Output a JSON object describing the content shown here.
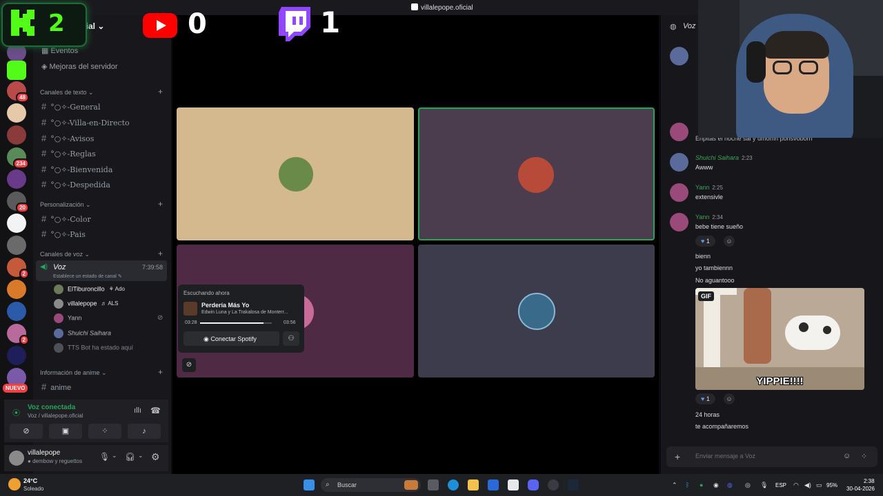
{
  "window": {
    "title": "villalepope.oficial"
  },
  "overlay": {
    "kick_count": "2",
    "youtube_count": "0",
    "twitch_count": "1"
  },
  "server": {
    "name": "cial"
  },
  "sidebar": {
    "nav": [
      "Eventos",
      "Mejoras del servidor"
    ],
    "categories": {
      "text": "Canales de texto",
      "personal": "Personalización",
      "voice": "Canales de voz",
      "anime": "Información de anime"
    },
    "text_channels": [
      "°○✧-General",
      "°○✧-Villa-en-Directo",
      "°○✧-Avisos",
      "°○✧-Reglas",
      "°○✧-Bienvenida",
      "°○✧-Despedida"
    ],
    "personal_channels": [
      "°○✧-Color",
      "°○✧-Pais"
    ],
    "voice": {
      "name": "Voz",
      "timer": "7:39:58",
      "status_placeholder": "Establece un estado de canal"
    },
    "voice_users": [
      {
        "name": "ElTiburoncillo",
        "live": "Ado"
      },
      {
        "name": "villalepope",
        "live": "ALS"
      },
      {
        "name": "Yann",
        "live": ""
      },
      {
        "name": "Shuichi Saihara",
        "live": ""
      },
      {
        "name": "TTS Bot ha estado aquí",
        "live": ""
      }
    ],
    "anime_channel": "anime",
    "badges": [
      "48",
      "234",
      "20",
      "2",
      "2"
    ],
    "new_badge": "NUEVO"
  },
  "connection": {
    "title": "Voz conectada",
    "subtitle": "Voz / villalepope.oficial"
  },
  "user": {
    "name": "villalepope",
    "status": "dembow y reguettos"
  },
  "now_playing": {
    "header": "Escuchando ahora",
    "song": "Perdería Más Yo",
    "artist": "Edwin Luna y La Trakalosa de Monterr...",
    "current": "03:28",
    "total": "03:56",
    "progress": 0.88,
    "connect_label": "Conectar Spotify"
  },
  "chat": {
    "channel": "Voz",
    "messages": [
      {
        "name": "Shuichi Saihara",
        "time": "2:23",
        "color": "#3ba55c",
        "lines": [
          "Awww"
        ]
      },
      {
        "name": "Yann",
        "time": "2:25",
        "color": "#3ba55c",
        "lines": [
          "extensivle"
        ]
      },
      {
        "name": "Yann",
        "time": "2:34",
        "color": "#3ba55c",
        "lines": [
          "bebe tiene sueño"
        ]
      }
    ],
    "loose_lines": [
      "bienn",
      "yo tambiennn",
      "No aguantooo"
    ],
    "reaction_count": "1",
    "gif_label": "GIF",
    "gif_caption": "YIPPIE!!!!",
    "after_gif": [
      "24 horas",
      "te acompañaremos"
    ],
    "input_placeholder": "Enviar mensaje a Voz",
    "partial_text": "Enpitas el noche sai y umomn ponsvoborn"
  },
  "taskbar": {
    "temp": "24°C",
    "weather": "Soleado",
    "search": "Buscar",
    "lang": "ESP",
    "battery": "95%",
    "time": "2:38",
    "date": "30-04-2026"
  },
  "colors": {
    "accent_green": "#23a55a",
    "kick_green": "#53fc18",
    "youtube_red": "#ff0000",
    "twitch_purple": "#9146ff",
    "tile1": "#d4b98f",
    "tile2": "#4b3c4e",
    "tile3": "#4e2a44",
    "tile4": "#3d3c4c"
  }
}
